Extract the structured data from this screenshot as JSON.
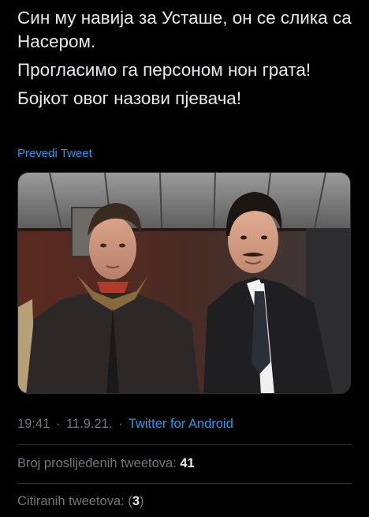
{
  "tweet": {
    "lines": [
      "Син му навија за Усташе, он се слика са Насером.",
      "Прогласимо га персоном нон грата!",
      "Бојкот овог назови пјевача!"
    ],
    "translate_label": "Prevedi Tweet"
  },
  "meta": {
    "time": "19:41",
    "date": "11.9.21.",
    "separator": "·",
    "source": "Twitter for Android"
  },
  "stats": {
    "retweets_label": "Broj proslijeđenih tweetova:",
    "retweets_count": "41",
    "quotes_label": "Citiranih tweetova:",
    "quotes_open": "(",
    "quotes_count": "3",
    "quotes_close": ")"
  },
  "colors": {
    "background": "#000000",
    "text": "#e7e9ea",
    "secondary": "#71767b",
    "accent": "#1d9bf0",
    "divider": "#2f3336"
  }
}
